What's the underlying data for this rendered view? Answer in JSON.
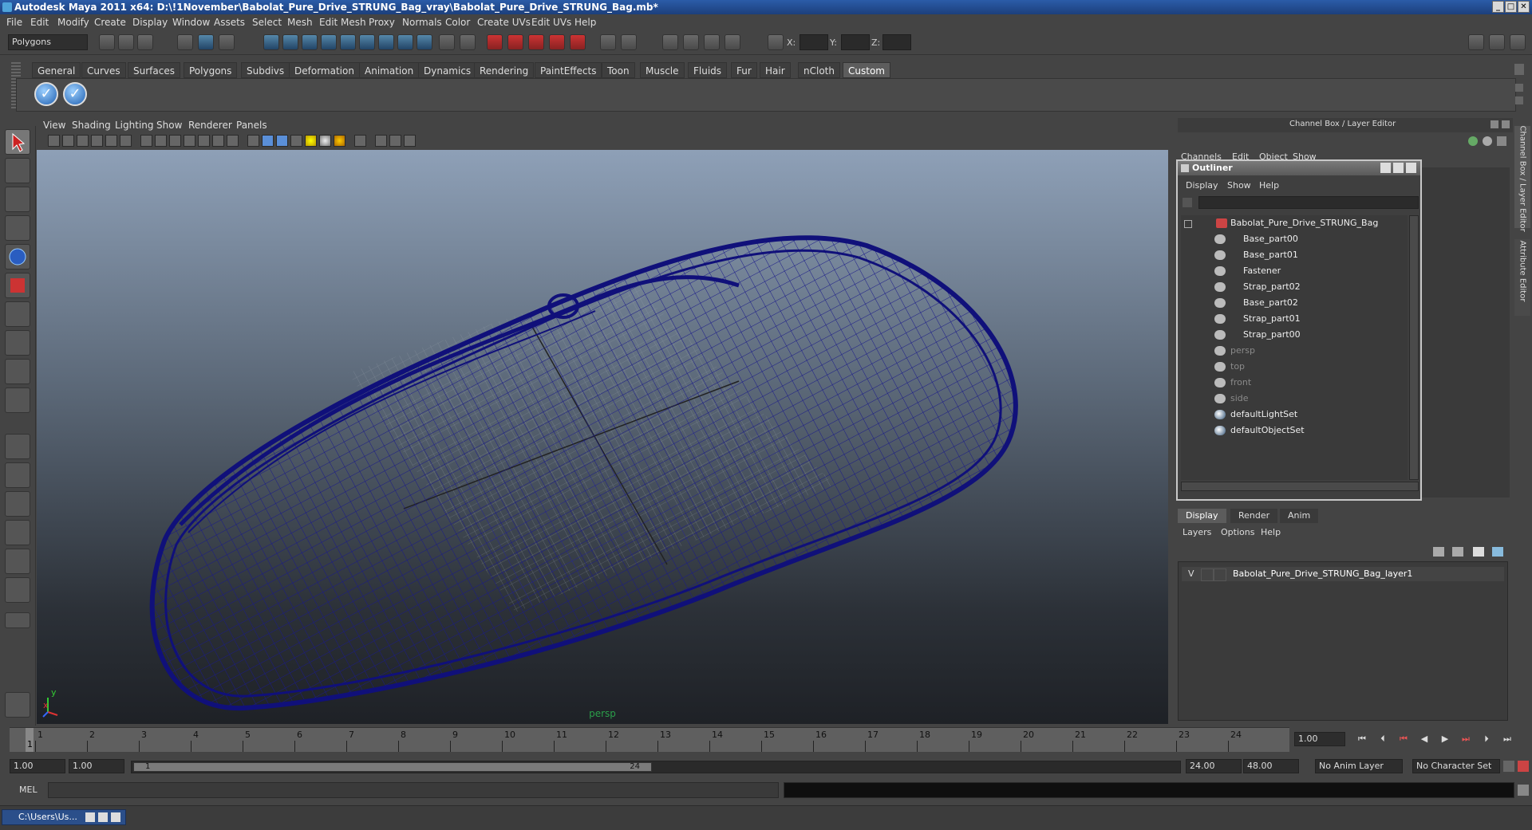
{
  "window": {
    "title": "Autodesk Maya 2011 x64: D:\\!1November\\Babolat_Pure_Drive_STRUNG_Bag_vray\\Babolat_Pure_Drive_STRUNG_Bag.mb*"
  },
  "menubar": [
    "File",
    "Edit",
    "Modify",
    "Create",
    "Display",
    "Window",
    "Assets",
    "Select",
    "Mesh",
    "Edit Mesh",
    "Proxy",
    "Normals",
    "Color",
    "Create UVs",
    "Edit UVs",
    "Help"
  ],
  "statusline": {
    "mode": "Polygons",
    "x_label": "X:",
    "y_label": "Y:",
    "z_label": "Z:"
  },
  "shelf_tabs": [
    "General",
    "Curves",
    "Surfaces",
    "Polygons",
    "Subdivs",
    "Deformation",
    "Animation",
    "Dynamics",
    "Rendering",
    "PaintEffects",
    "Toon",
    "Muscle",
    "Fluids",
    "Fur",
    "Hair",
    "nCloth",
    "Custom"
  ],
  "shelf_active_tab": "Custom",
  "viewport": {
    "menu": [
      "View",
      "Shading",
      "Lighting",
      "Show",
      "Renderer",
      "Panels"
    ],
    "camera_label": "persp",
    "axis_x": "x",
    "axis_y": "y"
  },
  "channel_box": {
    "title": "Channel Box / Layer Editor",
    "menu": [
      "Channels",
      "Edit",
      "Object",
      "Show"
    ],
    "side_tabs": [
      "Channel Box / Layer Editor",
      "Attribute Editor"
    ]
  },
  "outliner": {
    "title": "Outliner",
    "menu": [
      "Display",
      "Show",
      "Help"
    ],
    "root": "Babolat_Pure_Drive_STRUNG_Bag",
    "children": [
      "Base_part00",
      "Base_part01",
      "Fastener",
      "Strap_part02",
      "Base_part02",
      "Strap_part01",
      "Strap_part00"
    ],
    "cameras": [
      "persp",
      "top",
      "front",
      "side"
    ],
    "sets": [
      "defaultLightSet",
      "defaultObjectSet"
    ]
  },
  "layer_editor": {
    "tabs": [
      "Display",
      "Render",
      "Anim"
    ],
    "active_tab": "Display",
    "menu": [
      "Layers",
      "Options",
      "Help"
    ],
    "layers": [
      {
        "visible": "V",
        "name": "Babolat_Pure_Drive_STRUNG_Bag_layer1"
      }
    ]
  },
  "timeline": {
    "ticks": [
      "1",
      "2",
      "3",
      "4",
      "5",
      "6",
      "7",
      "8",
      "9",
      "10",
      "11",
      "12",
      "13",
      "14",
      "15",
      "16",
      "17",
      "18",
      "19",
      "20",
      "21",
      "22",
      "23",
      "24"
    ],
    "current_frame_marker": "1",
    "current_time": "1.00"
  },
  "range": {
    "start": "1.00",
    "playback_start": "1.00",
    "thumb_start": "1",
    "thumb_end": "24",
    "playback_end": "24.00",
    "end": "48.00",
    "anim_layer": "No Anim Layer",
    "character_set": "No Character Set"
  },
  "command_line": {
    "label": "MEL"
  },
  "taskbar": {
    "item": "C:\\Users\\Us..."
  }
}
